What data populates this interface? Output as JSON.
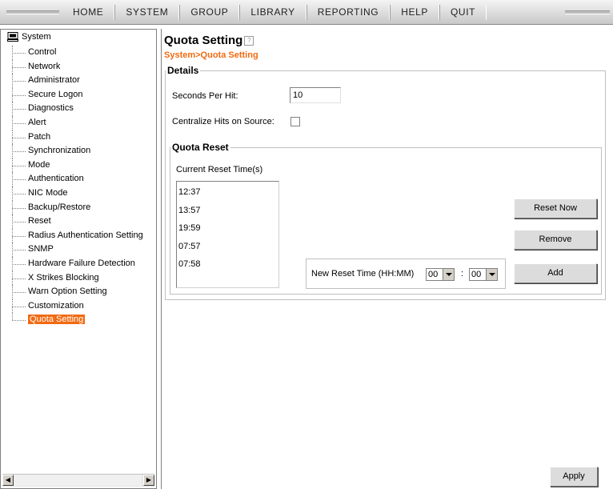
{
  "nav": {
    "items": [
      "HOME",
      "SYSTEM",
      "GROUP",
      "LIBRARY",
      "REPORTING",
      "HELP",
      "QUIT"
    ]
  },
  "tree": {
    "root_label": "System",
    "items": [
      "Control",
      "Network",
      "Administrator",
      "Secure Logon",
      "Diagnostics",
      "Alert",
      "Patch",
      "Synchronization",
      "Mode",
      "Authentication",
      "NIC Mode",
      "Backup/Restore",
      "Reset",
      "Radius Authentication Setting",
      "SNMP",
      "Hardware Failure Detection",
      "X Strikes Blocking",
      "Warn Option Setting",
      "Customization",
      "Quota Setting"
    ],
    "active_item": "Quota Setting"
  },
  "page": {
    "title": "Quota Setting",
    "breadcrumb": "System>Quota Setting"
  },
  "details": {
    "legend": "Details",
    "seconds_per_hit_label": "Seconds Per Hit:",
    "seconds_per_hit_value": "10",
    "centralize_label": "Centralize Hits on Source:",
    "centralize_checked": false
  },
  "quota_reset": {
    "legend": "Quota Reset",
    "current_label": "Current Reset Time(s)",
    "times": [
      "12:37",
      "13:57",
      "19:59",
      "07:57",
      "07:58"
    ],
    "new_reset_label": "New Reset Time (HH:MM)",
    "hour_value": "00",
    "minute_value": "00",
    "separator": ":",
    "reset_now_label": "Reset Now",
    "remove_label": "Remove",
    "add_label": "Add"
  },
  "footer": {
    "apply_label": "Apply"
  },
  "colors": {
    "accent": "#f26a12"
  }
}
